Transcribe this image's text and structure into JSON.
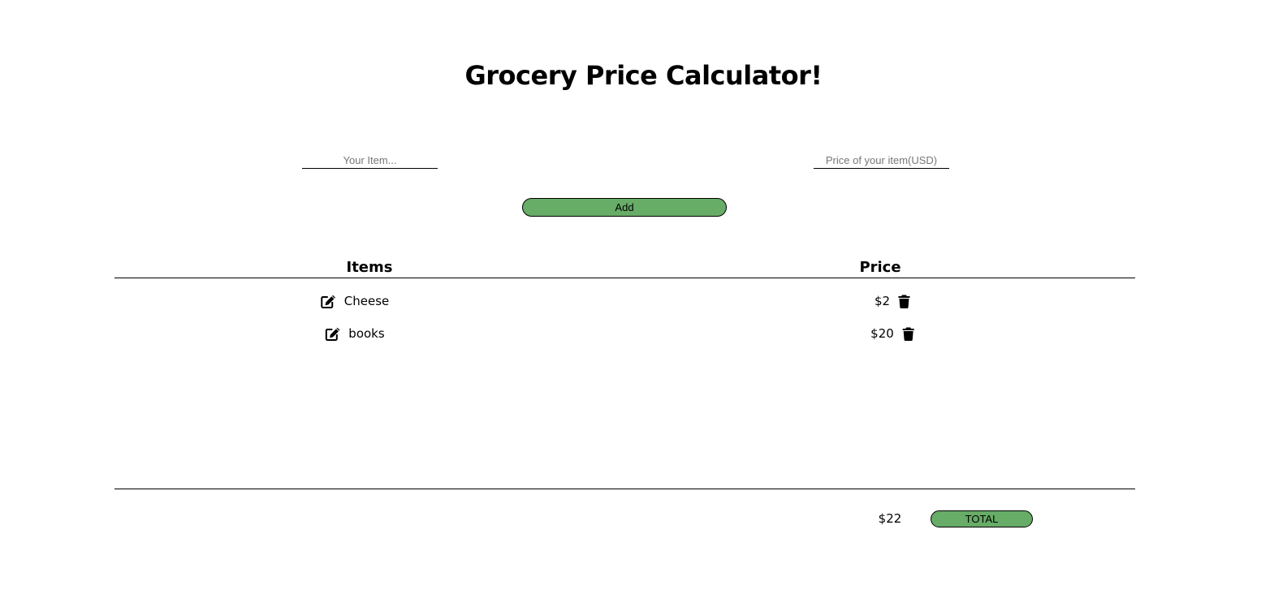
{
  "header": {
    "title": "Grocery Price Calculator!"
  },
  "form": {
    "item_placeholder": "Your Item...",
    "item_value": "",
    "price_placeholder": "Price of your item(USD)",
    "price_value": "",
    "add_label": "Add"
  },
  "table": {
    "columns": [
      "Items",
      "Price"
    ],
    "rows": [
      {
        "item": "Cheese",
        "price": "$2",
        "edit_icon": "edit-icon",
        "delete_icon": "trash-icon"
      },
      {
        "item": "books",
        "price": "$20",
        "edit_icon": "edit-icon",
        "delete_icon": "trash-icon"
      }
    ]
  },
  "footer": {
    "total_value": "$22",
    "total_label": "TOTAL"
  },
  "colors": {
    "button_green": "#67ac67",
    "text": "#000000",
    "background": "#ffffff"
  }
}
